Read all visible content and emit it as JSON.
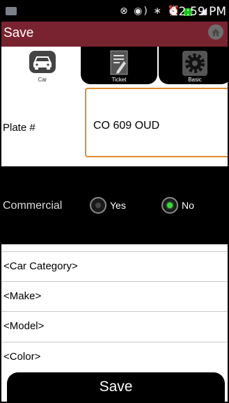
{
  "status_bar": {
    "time": "12:59 PM",
    "icons": "⊗ ◉) ∗ ⏰ ≋ ◢"
  },
  "title_bar": {
    "title": "Save"
  },
  "tabs": [
    {
      "label": "Car",
      "icon": "car-icon",
      "active": true
    },
    {
      "label": "Ticket",
      "icon": "ticket-icon",
      "active": false
    },
    {
      "label": "Basic",
      "icon": "gear-icon",
      "active": false
    }
  ],
  "form": {
    "plate_label": "Plate #",
    "plate_value": "CO 609 OUD",
    "commercial_label": "Commercial",
    "commercial_options": [
      {
        "label": "Yes",
        "selected": false
      },
      {
        "label": "No",
        "selected": true
      }
    ],
    "car_category": "<Car Category>",
    "make": "<Make>",
    "model": "<Model>",
    "color": "<Color>"
  },
  "save_button": {
    "label": "Save"
  },
  "colors": {
    "title_bar": "#7a2330",
    "input_focus": "#e2892b",
    "radio_on": "#33dd33"
  }
}
